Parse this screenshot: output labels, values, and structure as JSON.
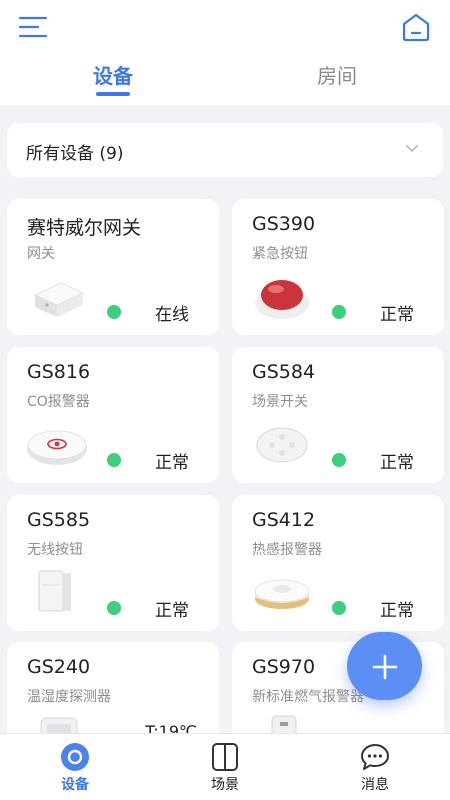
{
  "header": {
    "tabs": [
      {
        "label": "设备",
        "active": true
      },
      {
        "label": "房间",
        "active": false
      }
    ],
    "accent_color": "#3e78e8"
  },
  "filter": {
    "label": "所有设备 (9)"
  },
  "devices": [
    {
      "name": "赛特威尔网关",
      "type": "网关",
      "status": "在线",
      "icon": "gateway-icon"
    },
    {
      "name": "GS390",
      "type": "紧急按钮",
      "status": "正常",
      "icon": "emergency-button-icon"
    },
    {
      "name": "GS816",
      "type": "CO报警器",
      "status": "正常",
      "icon": "co-alarm-icon"
    },
    {
      "name": "GS584",
      "type": "场景开关",
      "status": "正常",
      "icon": "scene-switch-icon"
    },
    {
      "name": "GS585",
      "type": "无线按钮",
      "status": "正常",
      "icon": "wireless-button-icon"
    },
    {
      "name": "GS412",
      "type": "热感报警器",
      "status": "正常",
      "icon": "heat-alarm-icon"
    },
    {
      "name": "GS240",
      "type": "温湿度探测器",
      "reading": "T:19℃",
      "icon": "thermo-hygrometer-icon"
    },
    {
      "name": "GS970",
      "type": "新标准燃气报警器",
      "icon": "gas-alarm-icon"
    }
  ],
  "status_color": "#3ecf7c",
  "bottom_nav": [
    {
      "label": "设备",
      "icon": "devices-icon",
      "active": true
    },
    {
      "label": "场景",
      "icon": "scenes-icon",
      "active": false
    },
    {
      "label": "消息",
      "icon": "messages-icon",
      "active": false
    }
  ]
}
